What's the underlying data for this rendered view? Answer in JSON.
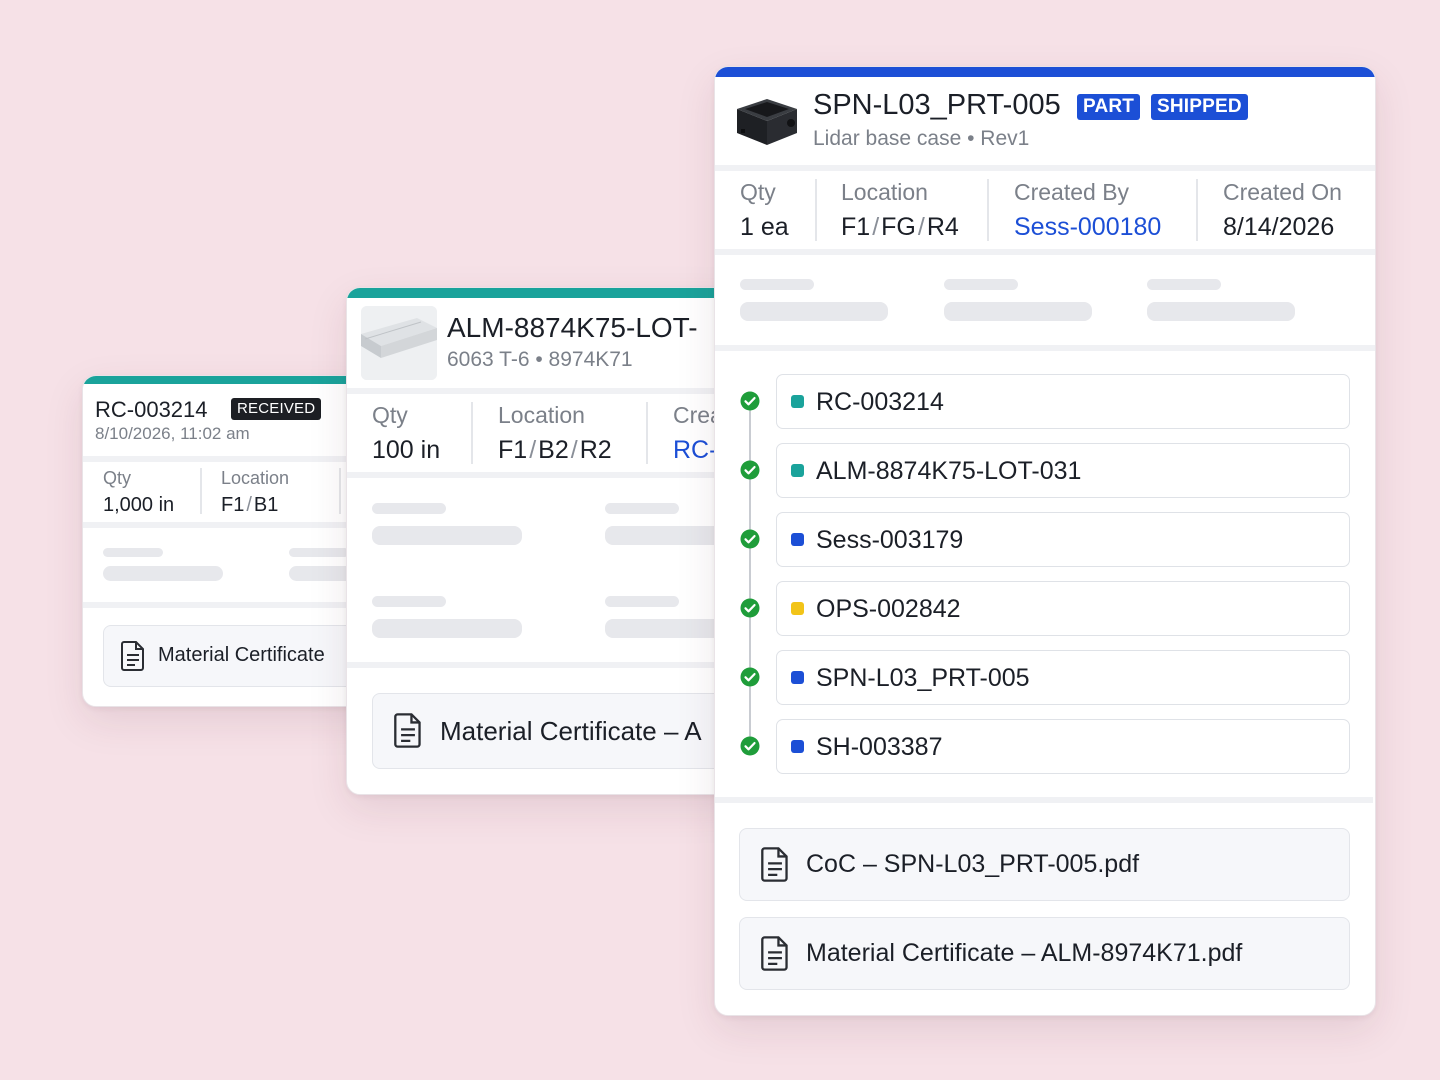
{
  "colors": {
    "background": "#f6e1e7",
    "teal": "#1aa39b",
    "blue": "#1c4fd6",
    "yellow": "#f2c418",
    "green_check": "#1f9d3a"
  },
  "card_receipt": {
    "title": "RC-003214",
    "badge": "RECEIVED",
    "timestamp": "8/10/2026, 11:02 am",
    "qty_label": "Qty",
    "qty_value": "1,000 in",
    "location_label": "Location",
    "location_parts": [
      "F1",
      "B1"
    ],
    "location_sep": "/",
    "document": "Material Certificate"
  },
  "card_lot": {
    "title": "ALM-8874K75-LOT-",
    "subtitle": "6063 T-6 • 8974K71",
    "qty_label": "Qty",
    "qty_value": "100 in",
    "location_label": "Location",
    "location_parts": [
      "F1",
      "B2",
      "R2"
    ],
    "location_sep": "/",
    "created_label": "Crea",
    "created_value": "RC-",
    "document": "Material Certificate – A",
    "thumbnail_icon": "aluminum-extrusion-image"
  },
  "card_part": {
    "title": "SPN-L03_PRT-005",
    "badges": [
      "PART",
      "SHIPPED"
    ],
    "subtitle": "Lidar base case • Rev1",
    "thumbnail_icon": "lidar-case-image",
    "fields": {
      "qty_label": "Qty",
      "qty_value": "1 ea",
      "location_label": "Location",
      "location_parts": [
        "F1",
        "FG",
        "R4"
      ],
      "location_sep": "/",
      "created_by_label": "Created By",
      "created_by_value": "Sess-000180",
      "created_on_label": "Created On",
      "created_on_value": "8/14/2026"
    },
    "timeline": [
      {
        "label": "RC-003214",
        "color": "#1aa39b",
        "status": "check-circle-icon"
      },
      {
        "label": "ALM-8874K75-LOT-031",
        "color": "#1aa39b",
        "status": "check-circle-icon"
      },
      {
        "label": "Sess-003179",
        "color": "#1c4fd6",
        "status": "check-circle-icon"
      },
      {
        "label": "OPS-002842",
        "color": "#f2c418",
        "status": "check-circle-icon"
      },
      {
        "label": "SPN-L03_PRT-005",
        "color": "#1c4fd6",
        "status": "check-circle-icon"
      },
      {
        "label": "SH-003387",
        "color": "#1c4fd6",
        "status": "check-circle-icon"
      }
    ],
    "documents": [
      "CoC – SPN-L03_PRT-005.pdf",
      "Material Certificate – ALM-8974K71.pdf"
    ]
  }
}
